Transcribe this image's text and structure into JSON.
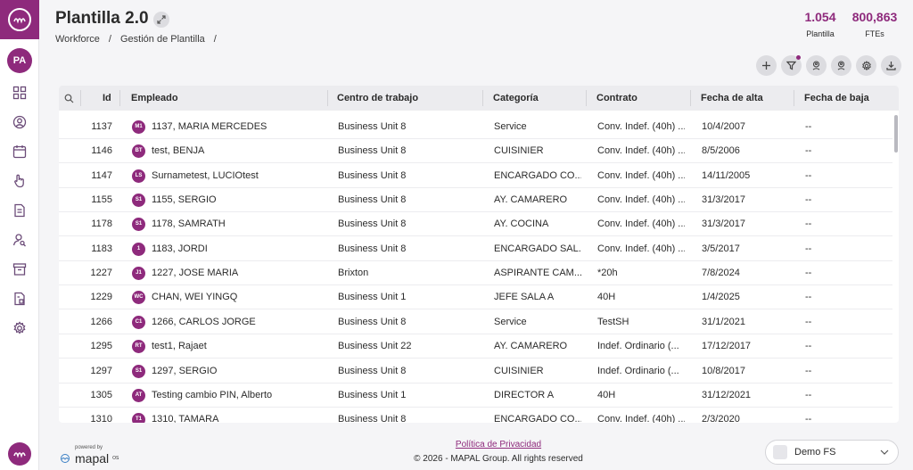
{
  "header": {
    "title": "Plantilla 2.0",
    "breadcrumb": [
      "Workforce",
      "/",
      "Gestión de Plantilla",
      "/"
    ]
  },
  "stats": [
    {
      "value": "1.054",
      "label": "Plantilla"
    },
    {
      "value": "800,863",
      "label": "FTEs"
    }
  ],
  "user": {
    "initials": "PA"
  },
  "sidebar": {
    "icons": [
      "dashboard-icon",
      "user-circle-icon",
      "calendar-icon",
      "hand-pointer-icon",
      "document-icon",
      "user-search-icon",
      "archive-icon",
      "report-icon",
      "settings-icon"
    ]
  },
  "toolbar": {
    "icons": [
      "add-icon",
      "filter-icon",
      "location-person-icon",
      "location-person-alt-icon",
      "settings-icon",
      "download-icon"
    ]
  },
  "table": {
    "columns": [
      "Id",
      "Empleado",
      "Centro de trabajo",
      "Categoría",
      "Contrato",
      "Fecha de alta",
      "Fecha de baja"
    ],
    "rows": [
      {
        "id": "1137",
        "initials": "M1",
        "name": "1137, MARIA MERCEDES",
        "centro": "Business Unit 8",
        "categoria": "Service",
        "contrato": "Conv. Indef. (40h) ...",
        "alta": "10/4/2007",
        "baja": "--"
      },
      {
        "id": "1146",
        "initials": "BT",
        "name": "test, BENJA",
        "centro": "Business Unit 8",
        "categoria": "CUISINIER",
        "contrato": "Conv. Indef. (40h) ...",
        "alta": "8/5/2006",
        "baja": "--"
      },
      {
        "id": "1147",
        "initials": "LS",
        "name": "Surnametest, LUCIOtest",
        "centro": "Business Unit 8",
        "categoria": "ENCARGADO CO...",
        "contrato": "Conv. Indef. (40h) ...",
        "alta": "14/11/2005",
        "baja": "--"
      },
      {
        "id": "1155",
        "initials": "S1",
        "name": "1155, SERGIO",
        "centro": "Business Unit 8",
        "categoria": "AY. CAMARERO",
        "contrato": "Conv. Indef. (40h) ...",
        "alta": "31/3/2017",
        "baja": "--"
      },
      {
        "id": "1178",
        "initials": "S1",
        "name": "1178, SAMRATH",
        "centro": "Business Unit 8",
        "categoria": "AY. COCINA",
        "contrato": "Conv. Indef. (40h) ...",
        "alta": "31/3/2017",
        "baja": "--"
      },
      {
        "id": "1183",
        "initials": "1",
        "name": "1183, JORDI",
        "centro": "Business Unit 8",
        "categoria": "ENCARGADO SAL...",
        "contrato": "Conv. Indef. (40h) ...",
        "alta": "3/5/2017",
        "baja": "--"
      },
      {
        "id": "1227",
        "initials": "J1",
        "name": "1227, JOSE MARIA",
        "centro": "Brixton",
        "categoria": "ASPIRANTE CAM...",
        "contrato": "*20h",
        "alta": "7/8/2024",
        "baja": "--"
      },
      {
        "id": "1229",
        "initials": "WC",
        "name": "CHAN, WEI YINGQ",
        "centro": "Business Unit 1",
        "categoria": "JEFE SALA A",
        "contrato": "40H",
        "alta": "1/4/2025",
        "baja": "--"
      },
      {
        "id": "1266",
        "initials": "C1",
        "name": "1266, CARLOS JORGE",
        "centro": "Business Unit 8",
        "categoria": "Service",
        "contrato": "TestSH",
        "alta": "31/1/2021",
        "baja": "--"
      },
      {
        "id": "1295",
        "initials": "RT",
        "name": "test1, Rajaet",
        "centro": "Business Unit 22",
        "categoria": "AY. CAMARERO",
        "contrato": "Indef. Ordinario (...",
        "alta": "17/12/2017",
        "baja": "--"
      },
      {
        "id": "1297",
        "initials": "S1",
        "name": "1297, SERGIO",
        "centro": "Business Unit 8",
        "categoria": "CUISINIER",
        "contrato": "Indef. Ordinario (...",
        "alta": "10/8/2017",
        "baja": "--"
      },
      {
        "id": "1305",
        "initials": "AT",
        "name": "Testing cambio PIN, Alberto",
        "centro": "Business Unit 1",
        "categoria": "DIRECTOR A",
        "contrato": "40H",
        "alta": "31/12/2021",
        "baja": "--"
      },
      {
        "id": "1310",
        "initials": "T1",
        "name": "1310, TAMARA",
        "centro": "Business Unit 8",
        "categoria": "ENCARGADO CO...",
        "contrato": "Conv. Indef. (40h) ...",
        "alta": "2/3/2020",
        "baja": "--"
      }
    ]
  },
  "footer": {
    "powered_by": "powered by",
    "brand": "mapal",
    "brand_suffix": "OS",
    "privacy": "Política de Privacidad",
    "copyright": "© 2026 - MAPAL Group. All rights reserved",
    "company": "Demo FS"
  },
  "colors": {
    "accent": "#8e2a7c"
  }
}
